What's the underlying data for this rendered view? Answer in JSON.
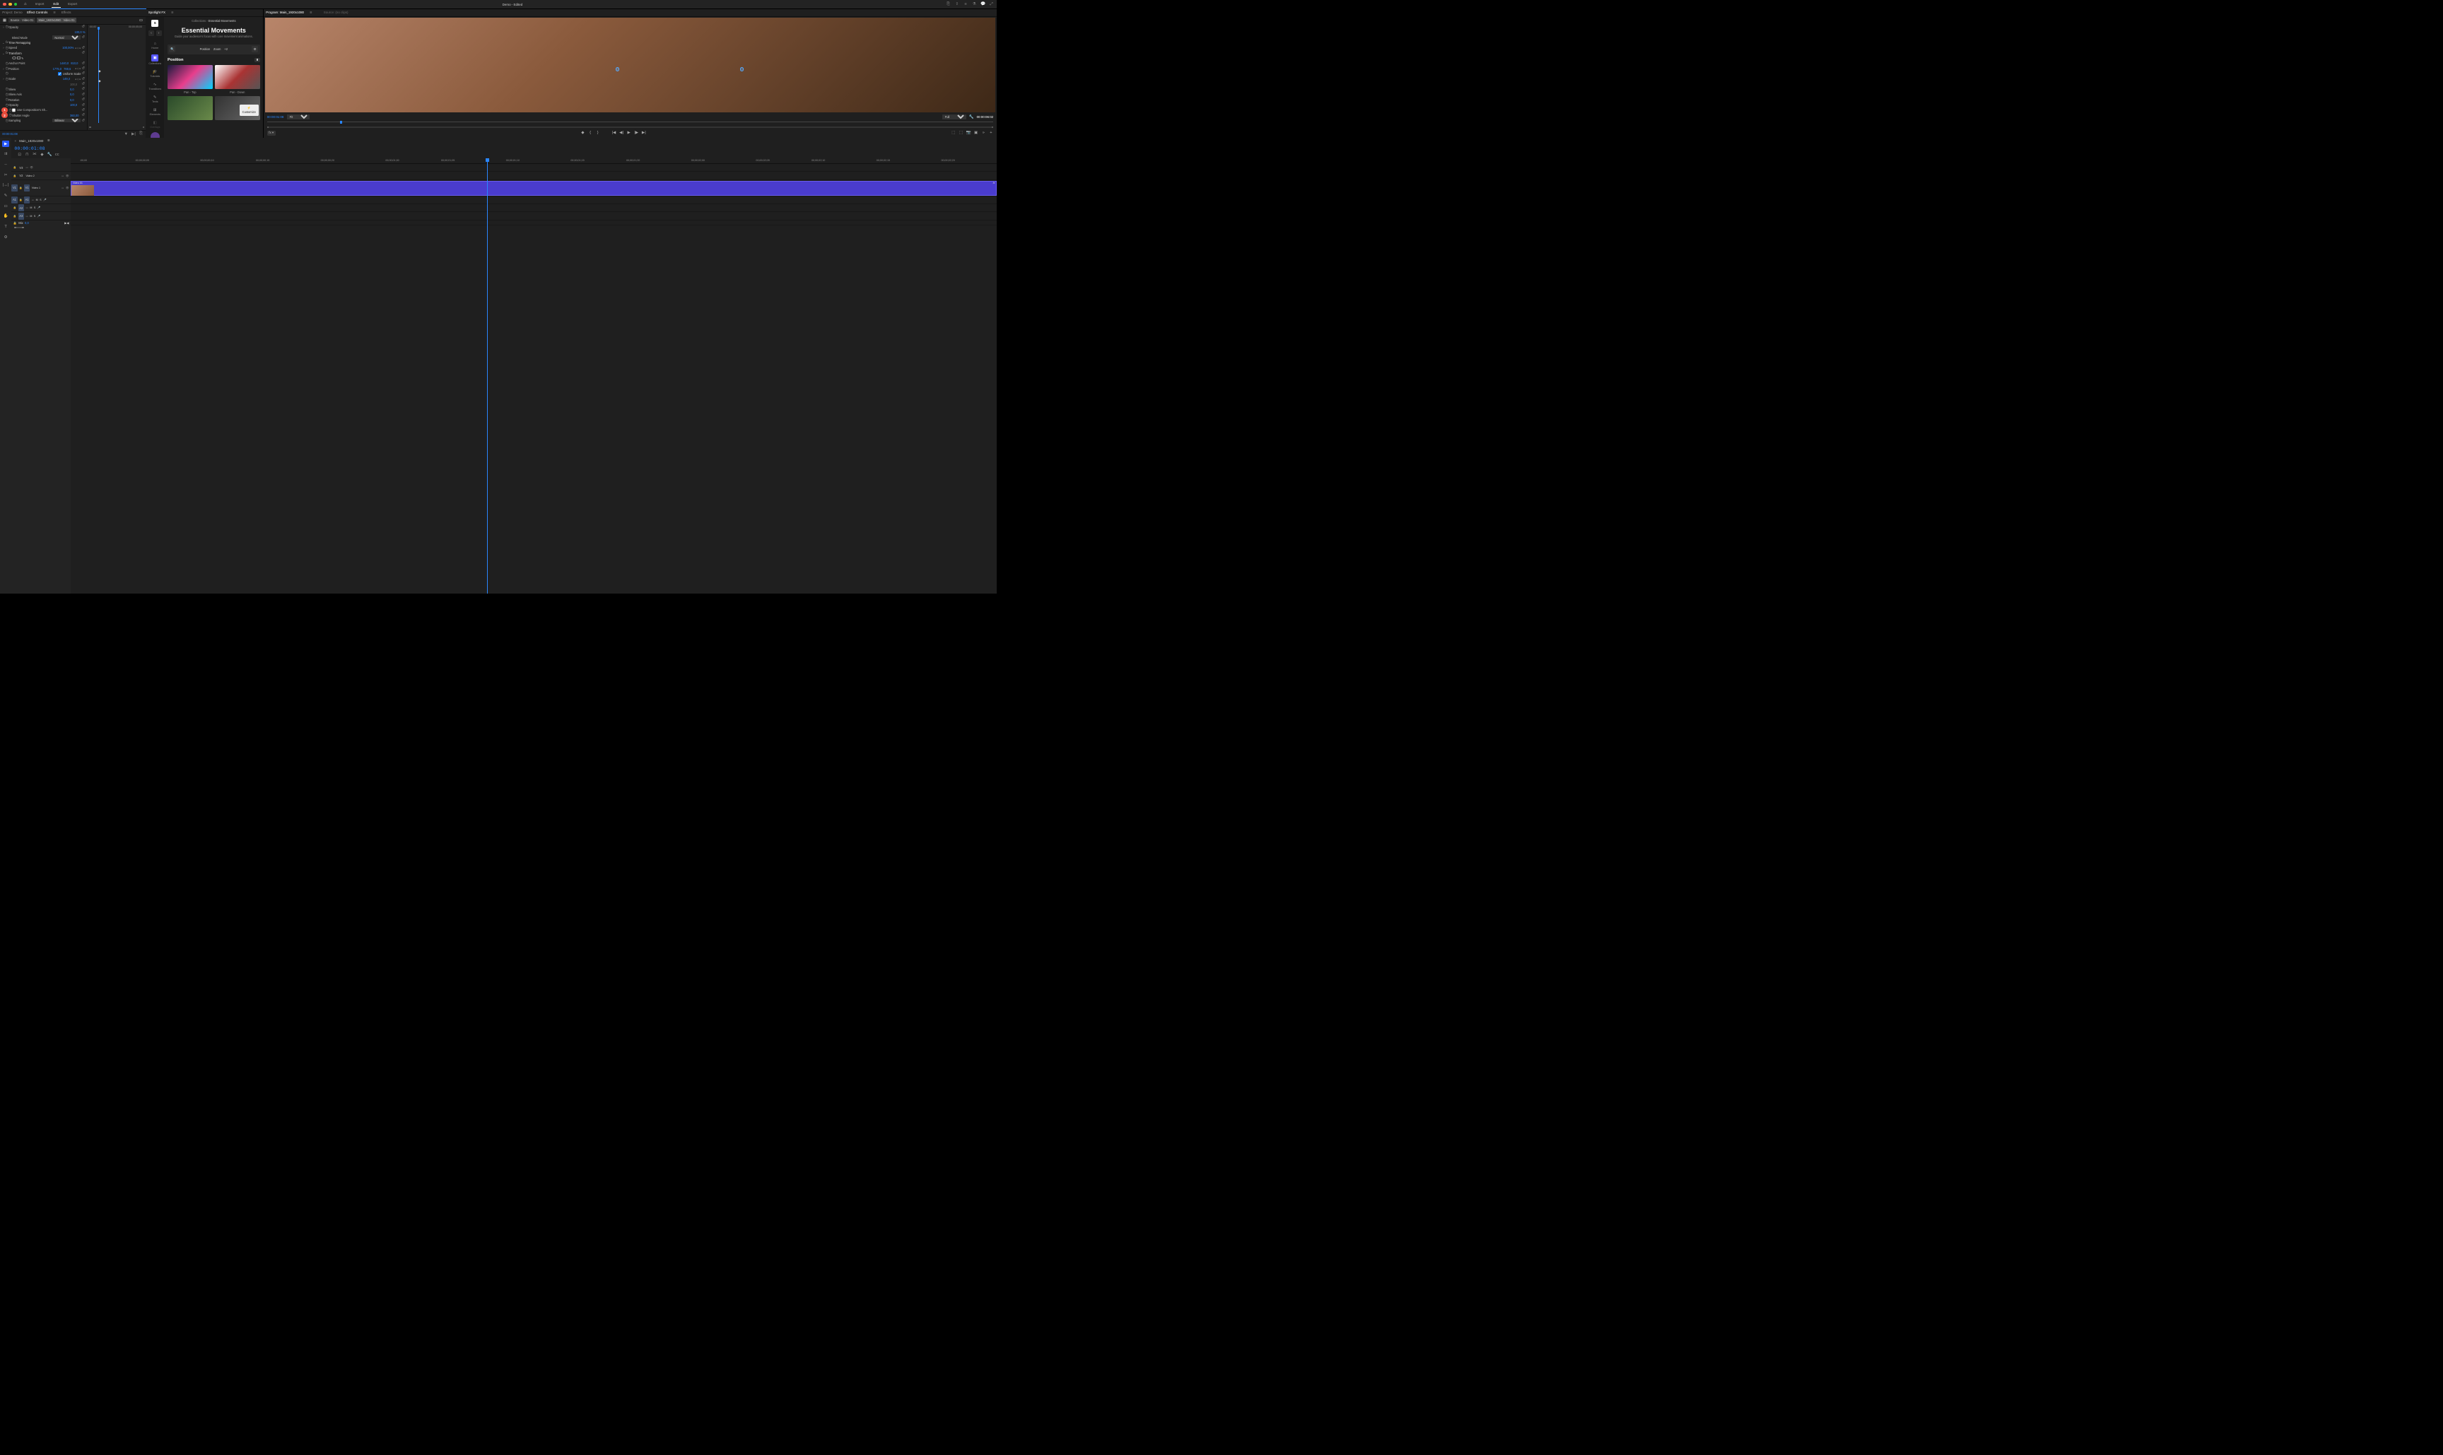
{
  "app": {
    "title": "Demo - Edited"
  },
  "top_menu": {
    "import": "Import",
    "edit": "Edit",
    "export": "Export"
  },
  "project_tab": "Project: Demo",
  "effect_controls_tab": "Effect Controls",
  "effects_tab": "Effects",
  "source_chip_1": "Source · Video 01",
  "source_chip_2": "Main_1920x1080 · Video 01",
  "ec_ruler_start": ":00;00",
  "ec_ruler_end": "00;00;05;00",
  "ec": {
    "opacity_label": "Opacity",
    "opacity_val": "100,0 %",
    "blend_label": "Blend Mode",
    "blend_val": "Normal",
    "time_remap": "Time Remapping",
    "speed_label": "Speed",
    "speed_val": "100,00%",
    "transform": "Transform",
    "anchor_label": "Anchor Point",
    "anchor_x": "1440,0",
    "anchor_y": "810,0",
    "position_label": "Position",
    "position_x": "1775,0",
    "position_y": "769,6",
    "uniform_scale": "Uniform Scale",
    "scale_label": "Scale",
    "scale_val": "149,3",
    "scale_h_val": "100,0",
    "skew_label": "Skew",
    "skew_val": "0,0",
    "skewaxis_label": "Skew Axis",
    "skewaxis_val": "0,0",
    "rotation_label": "Rotation",
    "rotation_val": "0,0",
    "opacity2_label": "Opacity",
    "opacity2_val": "100,0",
    "use_comp": "Use Composition's Sh...",
    "shutter_label": "Shutter Angle",
    "shutter_val": "360,00",
    "sampling_label": "Sampling",
    "sampling_val": "Bilinear"
  },
  "markers": {
    "one": "1",
    "two": "2"
  },
  "ec_footer_time": "00:00:01:08",
  "spotlight": {
    "tab": "Spotlight FX",
    "logo": "S",
    "nav": {
      "home": "Home",
      "collections": "Collections",
      "tutorials": "Tutorials",
      "transitions": "Transitions",
      "texts": "Texts",
      "elements": "Elements",
      "overlays": "Overlays"
    },
    "breadcrumb_root": "Collections",
    "breadcrumb_leaf": "Essential Movements",
    "hero_title": "Essential Movements",
    "hero_sub": "Guide your audience's focus with core movement animations.",
    "filter_position": "Position",
    "filter_zoom": "Zoom",
    "filter_plus": "+2",
    "section_title": "Position",
    "section_count": "8",
    "item_1": "Pan - Top",
    "item_2": "Pan - Down",
    "customize": "Customize"
  },
  "program": {
    "tab": "Program: Main_1920x1080",
    "source_label": "Source: (no clips)",
    "time_left": "00:00:01:08",
    "fit": "Fit",
    "full": "Full",
    "time_right": "00:00:06:02"
  },
  "timeline": {
    "seq_name": "Main_1920x1080",
    "timecode": "00:00:01:08",
    "ruler": [
      ":00;00",
      "00;00;00;05",
      "00;00;00;10",
      "00;00;00;15",
      "00;00;00;20",
      "00;00;01;00",
      "00;00;01;05",
      "00;00;01;10",
      "00;00;01;15",
      "00;00;01;20",
      "00;00;02;00",
      "00;00;02;05",
      "00;00;02;10",
      "00;00;02;15",
      "00;00;02;20"
    ],
    "tracks": {
      "v3": "V3",
      "v2": "V2",
      "v2_label": "Video 2",
      "v1_src": "V1",
      "v1": "V1",
      "v1_label": "Video 1",
      "a1_src": "A1",
      "a1": "A1",
      "a2": "A2",
      "a3": "A3",
      "m": "M",
      "s": "S",
      "mix": "Mix",
      "mix_val": "0,0"
    },
    "clip_name": "Video 01",
    "fx_badge": "fx"
  }
}
